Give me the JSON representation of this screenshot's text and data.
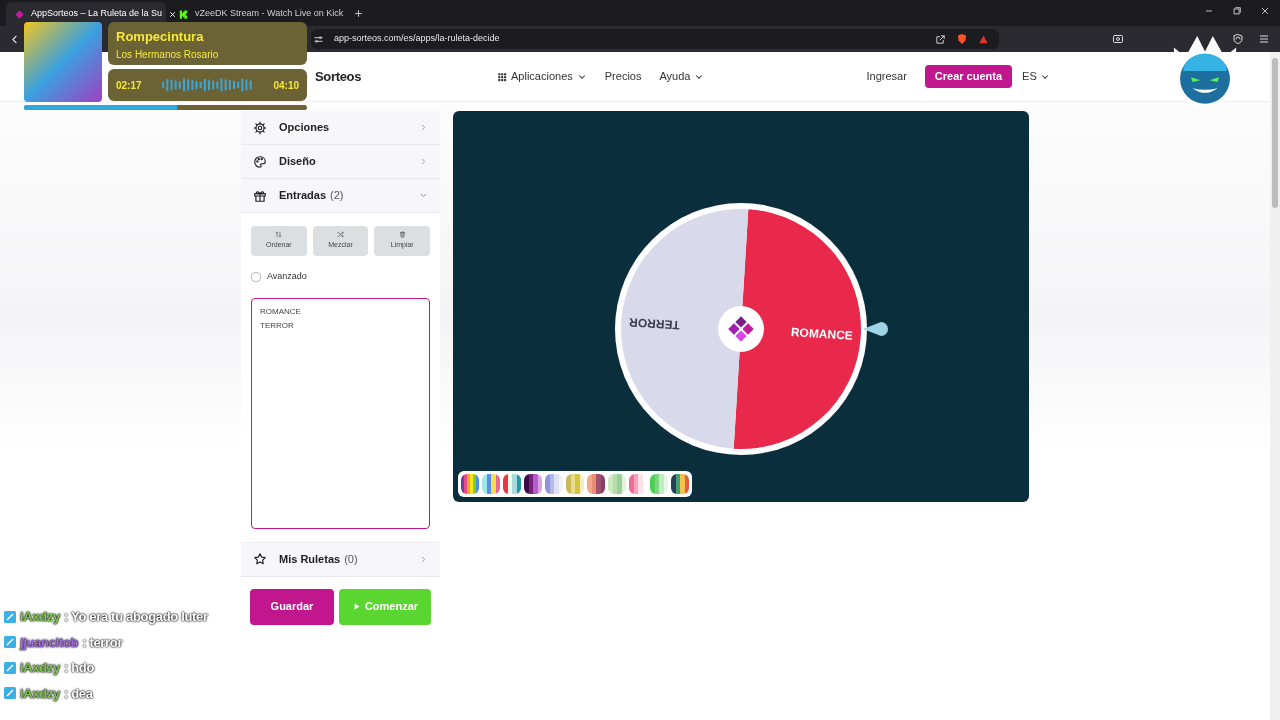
{
  "browser": {
    "tabs": [
      {
        "title": "AppSorteos – La Ruleta de la Su",
        "selected": true
      },
      {
        "title": "vZeeDK Stream - Watch Live on Kick",
        "selected": false
      }
    ],
    "url": "app-sorteos.com/es/apps/la-ruleta-decide"
  },
  "header": {
    "logo": "Sorteos",
    "nav": [
      {
        "label": "Aplicaciones",
        "dropdown": true
      },
      {
        "label": "Precios",
        "dropdown": false
      },
      {
        "label": "Ayuda",
        "dropdown": true
      }
    ],
    "login": "Ingresar",
    "signup": "Crear cuenta",
    "language": "ES"
  },
  "now_playing": {
    "title": "Rompecintura",
    "artist": "Los Hermanos Rosario",
    "elapsed": "02:17",
    "total": "04:10",
    "level": 0.54
  },
  "sidebar": {
    "sections": [
      {
        "label": "Opciones",
        "expanded": false
      },
      {
        "label": "Diseño",
        "expanded": false
      },
      {
        "label": "Entradas",
        "count": "(2)",
        "expanded": true
      }
    ],
    "tools": [
      {
        "label": "Ordenar"
      },
      {
        "label": "Mezclar"
      },
      {
        "label": "Limpiar"
      }
    ],
    "advanced": {
      "label": "Avanzado",
      "checked": false
    },
    "entries": "ROMANCE\nTERROR",
    "saved": {
      "label": "Mis Ruletas",
      "count": "(0)",
      "expanded": false
    },
    "save_button": "Guardar",
    "start_button": "Comenzar"
  },
  "wheel": {
    "segments": [
      {
        "label": "ROMANCE",
        "color": "#e8294b"
      },
      {
        "label": "TERROR",
        "color": "#d8daec"
      }
    ]
  },
  "chat": [
    {
      "user": "iAxdzy",
      "color": "#7ec850",
      "text": ": Yo era tu abogado luter"
    },
    {
      "user": "jjuancitob",
      "color": "#a36be0",
      "text": ": terror"
    },
    {
      "user": "iAxdzy",
      "color": "#7ec850",
      "text": ": hdo"
    },
    {
      "user": "iAxdzy",
      "color": "#7ec850",
      "text": ": dea"
    }
  ]
}
